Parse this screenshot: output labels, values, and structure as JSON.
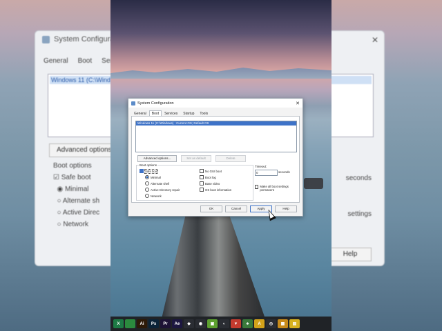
{
  "background_window": {
    "title": "System Configurat",
    "tabs": [
      "General",
      "Boot",
      "Servi"
    ],
    "os_entry": "Windows 11 (C:\\Wind",
    "advanced_label": "Advanced options...",
    "boot_options_label": "Boot options",
    "safe_boot": "Safe boot",
    "minimal": "Minimal",
    "alternate": "Alternate sh",
    "active_dir": "Active Direc",
    "network": "Network",
    "seconds": "seconds",
    "settings": "settings",
    "help": "Help"
  },
  "dialog": {
    "title": "System Configuration",
    "close_glyph": "✕",
    "tabs": [
      "General",
      "Boot",
      "Services",
      "Startup",
      "Tools"
    ],
    "active_tab": "Boot",
    "os_entry": "Windows 11 (C:\\Windows) : Current OS; Default OS",
    "buttons": {
      "advanced": "Advanced options...",
      "set_default": "Set as default",
      "delete": "Delete"
    },
    "boot_options": {
      "label": "Boot options",
      "safe_boot": "Safe boot",
      "minimal": "Minimal",
      "alternate_shell": "Alternate shell",
      "active_directory": "Active Directory repair",
      "network": "Network",
      "no_gui": "No GUI boot",
      "boot_log": "Boot log",
      "base_video": "Base video",
      "os_boot_info": "OS boot information"
    },
    "timeout_label": "Timeout:",
    "timeout_value": "0",
    "seconds": "seconds",
    "make_permanent": "Make all boot settings permanent",
    "footer": {
      "ok": "OK",
      "cancel": "Cancel",
      "apply": "Apply",
      "help": "Help"
    }
  },
  "taskbar": {
    "icons": [
      {
        "name": "excel-icon",
        "glyph": "X",
        "color": "#1d7a45"
      },
      {
        "name": "maps-icon",
        "glyph": "",
        "color": "#2b8a3e"
      },
      {
        "name": "illustrator-icon",
        "glyph": "Ai",
        "color": "#2d1a08"
      },
      {
        "name": "photoshop-icon",
        "glyph": "Ps",
        "color": "#0b2438"
      },
      {
        "name": "premiere-icon",
        "glyph": "Pr",
        "color": "#1d1235"
      },
      {
        "name": "aftereffects-icon",
        "glyph": "Ae",
        "color": "#1c1740"
      },
      {
        "name": "resolve-icon",
        "glyph": "◆",
        "color": "#2a2d33"
      },
      {
        "name": "obs-icon",
        "glyph": "◉",
        "color": "#2a2d33"
      },
      {
        "name": "camtasia-icon",
        "glyph": "▣",
        "color": "#5da130"
      },
      {
        "name": "app-icon",
        "glyph": "◐",
        "color": "#2a2d33"
      },
      {
        "name": "shield-icon",
        "glyph": "▼",
        "color": "#c43b2f"
      },
      {
        "name": "leaf-icon",
        "glyph": "♣",
        "color": "#3b7a3b"
      },
      {
        "name": "adobe-icon",
        "glyph": "A",
        "color": "#d3a21a"
      },
      {
        "name": "app2-icon",
        "glyph": "◎",
        "color": "#2a2d33"
      },
      {
        "name": "grid-icon",
        "glyph": "▦",
        "color": "#c78a1a"
      },
      {
        "name": "picture-icon",
        "glyph": "▤",
        "color": "#d6b11f"
      }
    ]
  }
}
